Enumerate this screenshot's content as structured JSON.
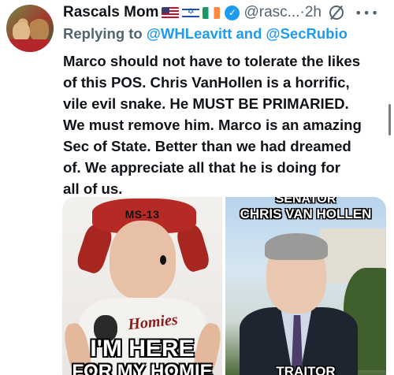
{
  "author": {
    "name": "Rascals Mom",
    "flags": [
      "us-flag",
      "israel-flag",
      "ireland-flag"
    ],
    "verified_icon": "check-icon",
    "handle": "@rasc...",
    "separator": "·",
    "time": "2h"
  },
  "reply": {
    "prefix": "Replying to",
    "mention1": "@WHLeavitt",
    "joiner": "and",
    "mention2": "@SecRubio"
  },
  "tweet_lines": [
    "Marco should not have to tolerate the likes",
    "of this POS.  Chris VanHollen is a horrific,",
    "vile evil snake. He MUST BE PRIMARIED.",
    "We must remove him. Marco is an amazing",
    "Sec of State.  Better than we had dreamed",
    "of.   We appreciate all that he is doing for",
    "all of us."
  ],
  "media": {
    "left": {
      "bandana_text": "MS-13",
      "shirt_text": "Homies",
      "meme_top": "I'M HERE",
      "meme_bottom": "FOR MY HOMIE"
    },
    "right": {
      "caption_top": "SENATOR",
      "caption_name": "CHRIS VAN HOLLEN",
      "caption_bottom": "TRAITOR"
    }
  },
  "colors": {
    "accent": "#1d9bf0",
    "text": "#0f1419",
    "muted": "#536471"
  }
}
